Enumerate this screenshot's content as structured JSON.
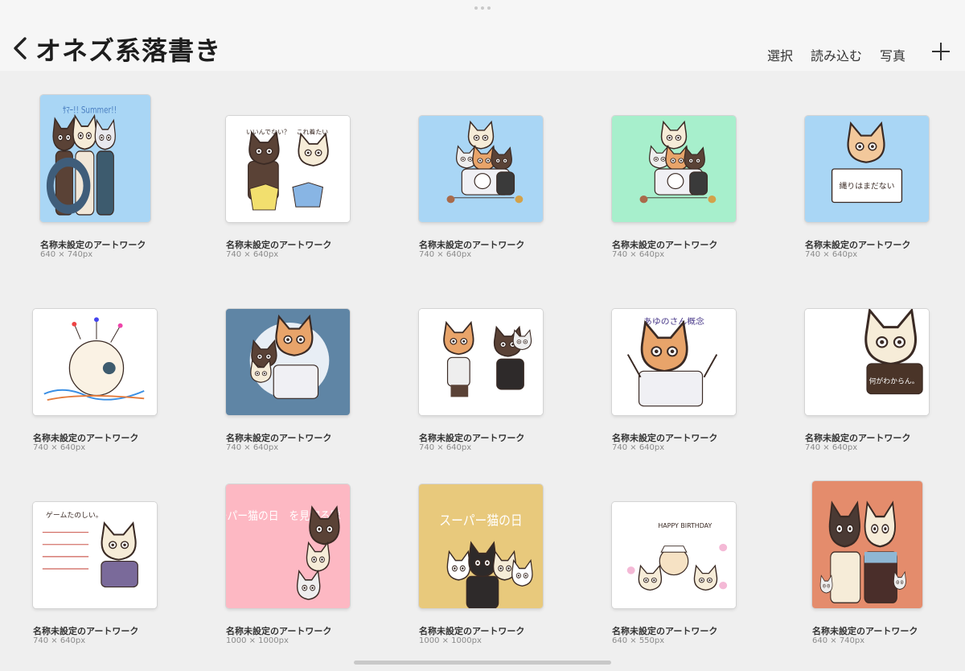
{
  "header": {
    "title": "オネズ系落書き",
    "actions": [
      "選択",
      "読み込む",
      "写真"
    ]
  },
  "colors": {
    "sky": "#a9d6f5",
    "mint": "#a7efcc",
    "slate": "#5f85a5",
    "pink": "#fdb8c3",
    "sand": "#e8c97c",
    "terracotta": "#e48c6c",
    "white": "#ffffff"
  },
  "artworks": [
    {
      "name": "名称未設定のアートワーク",
      "size": "640 × 740px",
      "bg": "#a9d6f5",
      "text": "ｻﾏｰ!! Summer!!",
      "icon": "summer-art-icon"
    },
    {
      "name": "名称未設定のアートワーク",
      "size": "740 × 640px",
      "bg": "#ffffff",
      "text": "いいんでない？　これ着たい",
      "icon": "clothes-art-icon"
    },
    {
      "name": "名称未設定のアートワーク",
      "size": "740 × 640px",
      "bg": "#a9d6f5",
      "text": "",
      "icon": "stacked-cats-art-icon"
    },
    {
      "name": "名称未設定のアートワーク",
      "size": "740 × 640px",
      "bg": "#a7efcc",
      "text": "",
      "icon": "stacked-cats-art-icon"
    },
    {
      "name": "名称未設定のアートワーク",
      "size": "740 × 640px",
      "bg": "#a9d6f5",
      "text": "縄りはまだない",
      "icon": "dog-sign-art-icon"
    },
    {
      "name": "名称未設定のアートワーク",
      "size": "740 × 640px",
      "bg": "#ffffff",
      "text": "",
      "icon": "hedgehog-art-icon"
    },
    {
      "name": "名称未設定のアートワーク",
      "size": "740 × 640px",
      "bg": "#5f85a5",
      "text": "",
      "icon": "cat-crowd-art-icon"
    },
    {
      "name": "名称未設定のアートワーク",
      "size": "740 × 640px",
      "bg": "#ffffff",
      "text": "",
      "icon": "cats-standing-art-icon"
    },
    {
      "name": "名称未設定のアートワーク",
      "size": "740 × 640px",
      "bg": "#ffffff",
      "text": "あゆのさん概念",
      "icon": "cat-waving-art-icon"
    },
    {
      "name": "名称未設定のアートワーク",
      "size": "740 × 640px",
      "bg": "#ffffff",
      "text": "何がわからん。",
      "icon": "cat-sign-art-icon"
    },
    {
      "name": "名称未設定のアートワーク",
      "size": "740 × 640px",
      "bg": "#ffffff",
      "text": "ゲームたのしい。",
      "icon": "cat-gaming-art-icon"
    },
    {
      "name": "名称未設定のアートワーク",
      "size": "1000 × 1000px",
      "bg": "#fdb8c3",
      "text": "スーパー猫の日　を見守る隊",
      "icon": "cat-day-art-icon"
    },
    {
      "name": "名称未設定のアートワーク",
      "size": "1000 × 1000px",
      "bg": "#e8c97c",
      "text": "スーパー猫の日",
      "icon": "cat-day-party-art-icon"
    },
    {
      "name": "名称未設定のアートワーク",
      "size": "640 × 550px",
      "bg": "#ffffff",
      "text": "HAPPY BIRTHDAY",
      "icon": "birthday-art-icon"
    },
    {
      "name": "名称未設定のアートワーク",
      "size": "640 × 740px",
      "bg": "#e48c6c",
      "text": "",
      "icon": "cat-dog-portrait-art-icon"
    }
  ]
}
